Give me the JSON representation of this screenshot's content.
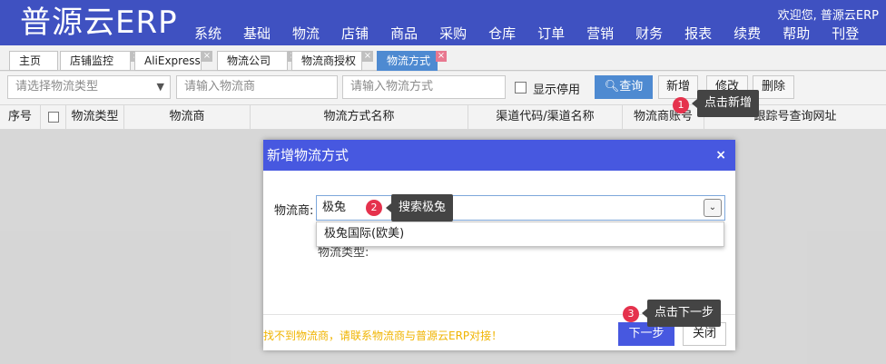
{
  "app": {
    "logo": "普源云ERP",
    "welcome": "欢迎您, 普源云ERP",
    "nav": [
      "系统",
      "基础",
      "物流",
      "店铺",
      "商品",
      "采购",
      "仓库",
      "订单",
      "营销",
      "财务",
      "报表",
      "续费",
      "帮助",
      "刊登"
    ]
  },
  "tabs": [
    {
      "label": "主页"
    },
    {
      "label": "店铺监控",
      "close": "×"
    },
    {
      "label": "AliExpress",
      "close": "×"
    },
    {
      "label": "物流公司",
      "close": "×"
    },
    {
      "label": "物流商授权",
      "close": "×"
    },
    {
      "label": "物流方式",
      "close": "×",
      "active": true
    }
  ],
  "filter": {
    "type_placeholder": "请选择物流类型",
    "provider_placeholder": "请输入物流商",
    "method_placeholder": "请输入物流方式",
    "show_disabled": "显示停用",
    "query": "查询",
    "add": "新增",
    "edit": "修改",
    "delete": "删除"
  },
  "table": {
    "columns": [
      "序号",
      "",
      "物流类型",
      "物流商",
      "物流方式名称",
      "渠道代码/渠道名称",
      "物流商账号",
      "跟踪号查询网址"
    ]
  },
  "dialog": {
    "title": "新增物流方式",
    "close": "×",
    "provider_label": "物流商:",
    "provider_value": "极兔",
    "option": "极兔国际(欧美)",
    "type_label": "物流类型:",
    "note": "找不到物流商，请联系物流商与普源云ERP对接！",
    "next": "下一步",
    "close_button": "关闭"
  },
  "callouts": [
    {
      "num": "1",
      "text": "点击新增"
    },
    {
      "num": "2",
      "text": "搜索极兔"
    },
    {
      "num": "3",
      "text": "点击下一步"
    }
  ],
  "colors": {
    "nav_bg": "#3f51c1",
    "dialog_title": "#4758e0",
    "active_tab": "#4e8ad1",
    "marker": "#e5324d",
    "note": "#f0b400"
  }
}
